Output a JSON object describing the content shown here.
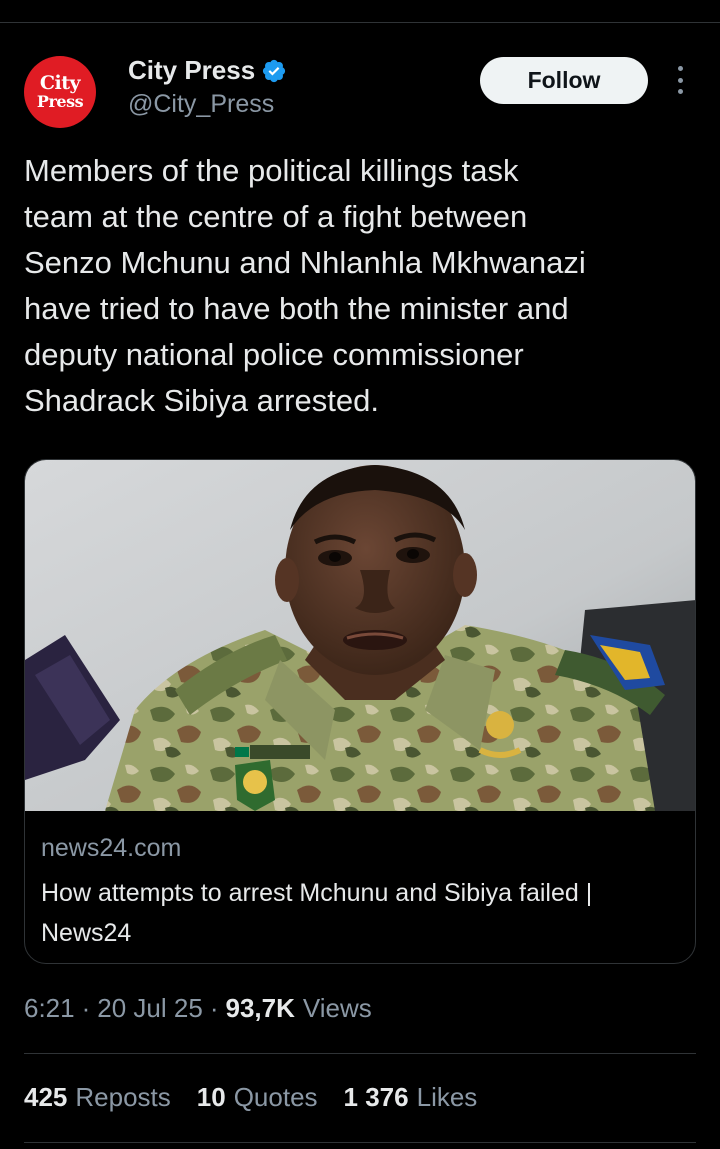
{
  "author": {
    "avatar_line1": "City",
    "avatar_line2": "Press",
    "display_name": "City Press",
    "handle": "@City_Press",
    "verified": true,
    "avatar_color": "#e01c24",
    "verified_color": "#1d9bf0"
  },
  "actions": {
    "follow_label": "Follow",
    "more_icon": "more-vertical-icon"
  },
  "tweet": {
    "text": "Members of the political killings task\nteam at the centre of a fight between\nSenzo Mchunu and Nhlanhla Mkhwanazi\nhave tried to have both the minister and\ndeputy national police commissioner\nShadrack Sibiya arrested."
  },
  "link_card": {
    "domain": "news24.com",
    "title": "How attempts to arrest Mchunu and Sibiya failed | News24"
  },
  "meta": {
    "time": "6:21",
    "date": "20 Jul 25",
    "separator": "·",
    "views_count": "93,7K",
    "views_label": "Views"
  },
  "stats": {
    "reposts_count": "425",
    "reposts_label": "Reposts",
    "quotes_count": "10",
    "quotes_label": "Quotes",
    "likes_count": "1 376",
    "likes_label": "Likes"
  }
}
